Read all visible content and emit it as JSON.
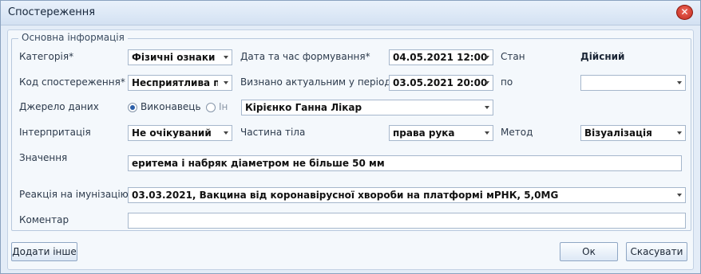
{
  "window": {
    "title": "Спостереження",
    "close": "✕"
  },
  "group": {
    "title": "Основна інформація"
  },
  "fields": {
    "category": {
      "label": "Категорія*",
      "value": "Фізичні ознаки"
    },
    "created": {
      "label": "Дата та час формування*",
      "value": "04.05.2021 12:00"
    },
    "state": {
      "label": "Стан",
      "value": "Дійсний"
    },
    "code": {
      "label": "Код спостереження*",
      "value": "Несприятлива под"
    },
    "period_from": {
      "label": "Визнано актуальним у період з*",
      "value": "03.05.2021 20:00"
    },
    "period_to": {
      "label": "по",
      "value": ""
    },
    "source": {
      "label": "Джерело даних",
      "option1": "Виконавець",
      "option2": "Ін",
      "value": "Кірієнко Ганна Лікар"
    },
    "interpretation": {
      "label": "Інтерпритація",
      "value": "Не очікуваний"
    },
    "body_part": {
      "label": "Частина тіла",
      "value": "права рука"
    },
    "method": {
      "label": "Метод",
      "value": "Візуалізація"
    },
    "value": {
      "label": "Значення",
      "value": "еритема і набряк діаметром не більше 50 мм"
    },
    "reaction": {
      "label": "Реакція на імунізацію*",
      "value": "03.03.2021, Вакцина від коронавірусної хвороби на платформі мРНК, 5,0MG"
    },
    "comment": {
      "label": "Коментар",
      "value": ""
    }
  },
  "buttons": {
    "add_other": "Додати інше",
    "ok": "Ок",
    "cancel": "Скасувати"
  }
}
